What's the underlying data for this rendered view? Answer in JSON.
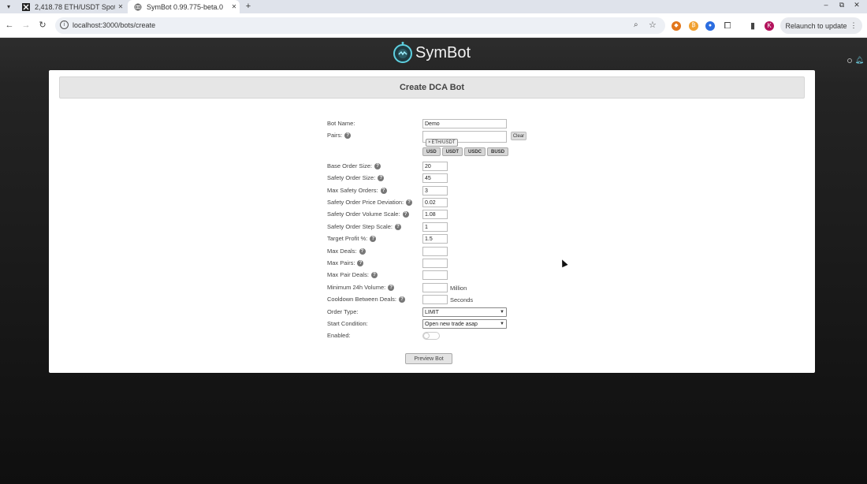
{
  "browser": {
    "tabs": [
      {
        "title": "2,418.78 ETH/USDT Spot",
        "icon": "exchange-icon"
      },
      {
        "title": "SymBot 0.99.775-beta.0",
        "icon": "globe-icon"
      }
    ],
    "url": "localhost:3000/bots/create",
    "relaunch_label": "Relaunch to update",
    "profile_initial": "K"
  },
  "app": {
    "brand": "SymBot",
    "accent": "#5ed0e0"
  },
  "page": {
    "title": "Create DCA Bot",
    "preview_label": "Preview Bot"
  },
  "form": {
    "bot_name": {
      "label": "Bot Name:",
      "value": "Demo"
    },
    "pairs": {
      "label": "Pairs:",
      "chips": [
        "ETH/USDT"
      ],
      "clear_label": "Clear",
      "quote_buttons": [
        "USD",
        "USDT",
        "USDC",
        "BUSD"
      ]
    },
    "base_order_size": {
      "label": "Base Order Size:",
      "value": "20"
    },
    "safety_order_size": {
      "label": "Safety Order Size:",
      "value": "45"
    },
    "max_safety_orders": {
      "label": "Max Safety Orders:",
      "value": "3"
    },
    "so_price_deviation": {
      "label": "Safety Order Price Deviation:",
      "value": "0.02"
    },
    "so_volume_scale": {
      "label": "Safety Order Volume Scale:",
      "value": "1.08"
    },
    "so_step_scale": {
      "label": "Safety Order Step Scale:",
      "value": "1"
    },
    "target_profit": {
      "label": "Target Profit %:",
      "value": "1.5"
    },
    "max_deals": {
      "label": "Max Deals:",
      "value": ""
    },
    "max_pairs": {
      "label": "Max Pairs:",
      "value": ""
    },
    "max_pair_deals": {
      "label": "Max Pair Deals:",
      "value": ""
    },
    "min_24h_volume": {
      "label": "Minimum 24h Volume:",
      "value": "",
      "suffix": "Million"
    },
    "cooldown": {
      "label": "Cooldown Between Deals:",
      "value": "",
      "suffix": "Seconds"
    },
    "order_type": {
      "label": "Order Type:",
      "value": "LIMIT"
    },
    "start_condition": {
      "label": "Start Condition:",
      "value": "Open new trade asap"
    },
    "enabled": {
      "label": "Enabled:",
      "value": false
    }
  }
}
